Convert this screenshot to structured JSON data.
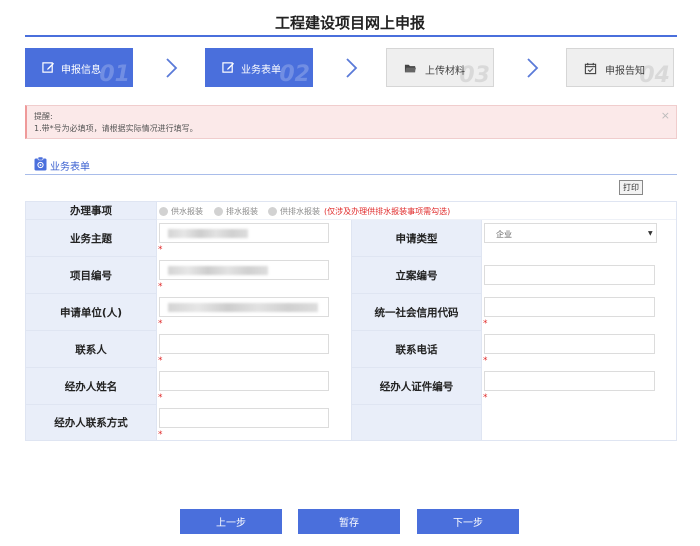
{
  "page_title": "工程建设项目网上申报",
  "steps": [
    {
      "label": "申报信息",
      "num": "01",
      "state": "active",
      "icon": "edit-icon"
    },
    {
      "label": "业务表单",
      "num": "02",
      "state": "active",
      "icon": "edit-icon"
    },
    {
      "label": "上传材料",
      "num": "03",
      "state": "inactive",
      "icon": "folder-icon"
    },
    {
      "label": "申报告知",
      "num": "04",
      "state": "inactive",
      "icon": "calendar-check-icon"
    }
  ],
  "alert": {
    "title": "提醒:",
    "text": "1.带*号为必填项，请根据实际情况进行填写。",
    "close": "×"
  },
  "section": {
    "title": "业务表单",
    "icon": "form-icon"
  },
  "print_label": "打印",
  "form": {
    "row1": {
      "label": "办理事项",
      "options": [
        "供水报装",
        "排水报装",
        "供排水报装"
      ],
      "note": "(仅涉及办理供排水报装事项需勾选)"
    },
    "business_subject": {
      "label": "业务主题",
      "value": ""
    },
    "apply_type": {
      "label": "申请类型",
      "value": "企业"
    },
    "project_no": {
      "label": "项目编号",
      "value": ""
    },
    "filing_no": {
      "label": "立案编号",
      "value": ""
    },
    "applicant": {
      "label": "申请单位(人)",
      "value": ""
    },
    "credit_code": {
      "label": "统一社会信用代码",
      "value": ""
    },
    "contact": {
      "label": "联系人",
      "value": ""
    },
    "phone": {
      "label": "联系电话",
      "value": ""
    },
    "agent_name": {
      "label": "经办人姓名",
      "value": ""
    },
    "agent_id": {
      "label": "经办人证件编号",
      "value": ""
    },
    "agent_contact": {
      "label": "经办人联系方式",
      "value": ""
    },
    "required_mark": "*"
  },
  "buttons": {
    "prev": "上一步",
    "save": "暂存",
    "next": "下一步"
  },
  "colors": {
    "accent": "#4a6fdc",
    "label_bg": "#e9eef9",
    "required": "#e02a2a",
    "alert_bg": "#fbe9e9"
  }
}
